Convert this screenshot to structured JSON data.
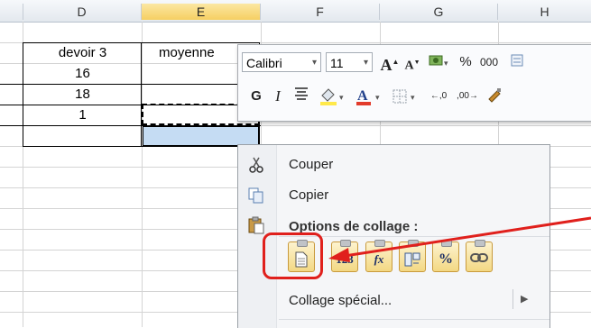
{
  "columns": [
    {
      "name": "D",
      "selected": false
    },
    {
      "name": "E",
      "selected": true
    },
    {
      "name": "F",
      "selected": false
    },
    {
      "name": "G",
      "selected": false
    },
    {
      "name": "H",
      "selected": false
    }
  ],
  "cells": {
    "d_header": "devoir 3",
    "e_header": "moyenne",
    "d_row1": "16",
    "d_row2": "18",
    "d_row3": "1"
  },
  "mini_toolbar": {
    "font_name": "Calibri",
    "font_size": "11",
    "bold_label": "G",
    "italic_label": "I",
    "percent_label": "%",
    "thousands_label": "000",
    "font_color": "#e23b2b",
    "fill_color": "#ffe94a"
  },
  "context_menu": {
    "cut_label": "Couper",
    "copy_label": "Copier",
    "paste_options_label": "Options de collage :",
    "paste_special_label": "Collage spécial...",
    "paste_buttons": [
      {
        "name": "paste-button",
        "glyph": ""
      },
      {
        "name": "paste-values-button",
        "glyph": "123"
      },
      {
        "name": "paste-formulas-button",
        "glyph": "fx"
      },
      {
        "name": "paste-transpose-button",
        "glyph": ""
      },
      {
        "name": "paste-formatting-button",
        "glyph": "%"
      },
      {
        "name": "paste-link-button",
        "glyph": ""
      }
    ]
  },
  "annotation": {
    "color": "#e0201c"
  }
}
